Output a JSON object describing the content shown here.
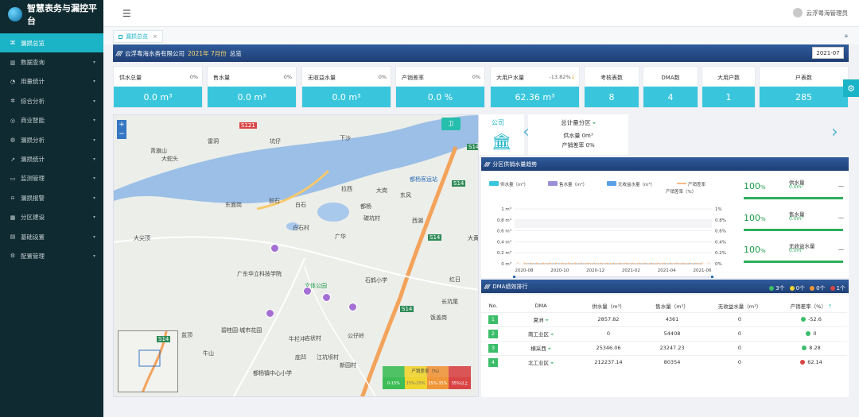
{
  "app": {
    "title": "智慧表务与漏控平台"
  },
  "sidebar": {
    "items": [
      {
        "label": "漏损总览",
        "icon": "dashboard-icon",
        "active": true
      },
      {
        "label": "数据查询",
        "icon": "bar-chart-icon"
      },
      {
        "label": "用量统计",
        "icon": "pie-chart-icon"
      },
      {
        "label": "综合分析",
        "icon": "settings-icon"
      },
      {
        "label": "商业智能",
        "icon": "coin-icon"
      },
      {
        "label": "漏损分析",
        "icon": "globe-icon"
      },
      {
        "label": "漏损统计",
        "icon": "line-chart-icon"
      },
      {
        "label": "监测管理",
        "icon": "monitor-icon"
      },
      {
        "label": "漏损报警",
        "icon": "alarm-icon"
      },
      {
        "label": "分区建设",
        "icon": "building-icon"
      },
      {
        "label": "基础设置",
        "icon": "folder-icon"
      },
      {
        "label": "配置管理",
        "icon": "gear-icon"
      }
    ]
  },
  "topbar": {
    "user": "云浮粤海管理员"
  },
  "tabs": [
    {
      "label": "漏损总览"
    }
  ],
  "header": {
    "company": "云浮粤海水务有限公司",
    "month": "2021年 7月份",
    "suffix": "总览",
    "date": "2021-07"
  },
  "stats": [
    {
      "label": "供水总量",
      "pct": "0%",
      "value": "0.0 m³"
    },
    {
      "label": "售水量",
      "pct": "0%",
      "value": "0.0 m³"
    },
    {
      "label": "无收益水量",
      "pct": "0%",
      "value": "0.0 m³"
    },
    {
      "label": "产销差率",
      "pct": "0%",
      "value": "0.0 %"
    },
    {
      "label": "大用户水量",
      "pct": "-13.82%",
      "value": "62.36 m³"
    },
    {
      "label": "考核表数",
      "value": "8"
    },
    {
      "label": "DMA数",
      "value": "4"
    },
    {
      "label": "大用户数",
      "value": "1"
    },
    {
      "label": "户表数",
      "value": "285"
    }
  ],
  "map": {
    "toggle": "卫",
    "zoom_in": "+",
    "zoom_out": "−",
    "labels": [
      "青旗山",
      "都杨客运站",
      "东风",
      "白石村",
      "广华",
      "大尖顶",
      "广东华立科技学院",
      "文体公园",
      "石鹤小学",
      "红日",
      "饭盖岗",
      "碧桂园·城市花园",
      "公仔岭",
      "吉状村",
      "盆顶",
      "牛山",
      "新园村",
      "都杨镇中心小学",
      "雷洞",
      "坑仔",
      "牛栏冲",
      "前石",
      "白石",
      "碳坑村",
      "庇凹",
      "东面岗",
      "大黄山",
      "拉西",
      "大岗",
      "都杨",
      "江坑坝村",
      "西湖",
      "长坑尾",
      "大蛇头",
      "S121",
      "S14",
      "S14",
      "S14",
      "S14",
      "下沙"
    ],
    "minimap_label": "S14",
    "legend": {
      "title": "产销差率（%）",
      "cells": [
        "0-15%",
        "15%-25%",
        "25%-35%",
        "35%以上"
      ]
    }
  },
  "company_panel": {
    "title": "公司"
  },
  "zone_card": {
    "title": "总计量分区",
    "supply": "供水量 0m³",
    "rate": "产销差率 0%"
  },
  "trend": {
    "title": "分区供销水量趋势"
  },
  "chart_data": {
    "type": "line",
    "x": [
      "2020-08",
      "2020-10",
      "2020-12",
      "2021-02",
      "2021-04",
      "2021-06"
    ],
    "series": [
      {
        "name": "供水量（m³）",
        "color": "#39c6dd",
        "values": [
          0,
          0,
          0,
          0,
          0,
          0
        ]
      },
      {
        "name": "售水量（m³）",
        "color": "#9b8fd6",
        "values": [
          0,
          0,
          0,
          0,
          0,
          0
        ]
      },
      {
        "name": "无收益水量（m³）",
        "color": "#5aa0e6",
        "values": [
          0,
          0,
          0,
          0,
          0,
          0
        ]
      },
      {
        "name": "产销差率",
        "color": "#f5a25c",
        "values": [
          0,
          0,
          0,
          0,
          0,
          0
        ]
      }
    ],
    "y_left": [
      "1 m³",
      "0.8 m³",
      "0.6 m³",
      "0.4 m³",
      "0.2 m³",
      "0 m³"
    ],
    "y_right": [
      "1%",
      "0.8%",
      "0.6%",
      "0.4%",
      "0.2%",
      "0%"
    ],
    "y_right_label": "产销差率（%）",
    "ylim": [
      0,
      1
    ]
  },
  "ratios": [
    {
      "pct": "100",
      "unit": "%",
      "label": "供水量",
      "value": "0.0m³",
      "dash": "—"
    },
    {
      "pct": "100",
      "unit": "%",
      "label": "售水量",
      "value": "0.0m³",
      "dash": "—"
    },
    {
      "pct": "100",
      "unit": "%",
      "label": "无收益水量",
      "value": "0.0m³",
      "dash": "—"
    }
  ],
  "rank": {
    "title": "DMA绩效排行",
    "counts": [
      {
        "color": "#3cbd6a",
        "text": "3个"
      },
      {
        "color": "#f0d430",
        "text": "0个"
      },
      {
        "color": "#f0963a",
        "text": "0个"
      },
      {
        "color": "#d94545",
        "text": "1个"
      }
    ],
    "headers": [
      "No.",
      "DMA",
      "供水量（m³）",
      "售水量（m³）",
      "无收益水量（m³）",
      "产销差率（%）"
    ],
    "sort_icon": "⇡",
    "rows": [
      {
        "no": "1",
        "name": "夏洲",
        "supply": "2857.82",
        "sale": "4361",
        "nrw": "0",
        "rate": "-52.6",
        "color": "#3cbd6a"
      },
      {
        "no": "2",
        "name": "南工业区",
        "supply": "0",
        "sale": "54408",
        "nrw": "0",
        "rate": "0",
        "color": "#3cbd6a"
      },
      {
        "no": "3",
        "name": "横采西",
        "supply": "25346.06",
        "sale": "23247.23",
        "nrw": "0",
        "rate": "8.28",
        "color": "#3cbd6a"
      },
      {
        "no": "4",
        "name": "北工业区",
        "supply": "212237.14",
        "sale": "80354",
        "nrw": "0",
        "rate": "62.14",
        "color": "#d94545"
      }
    ]
  }
}
